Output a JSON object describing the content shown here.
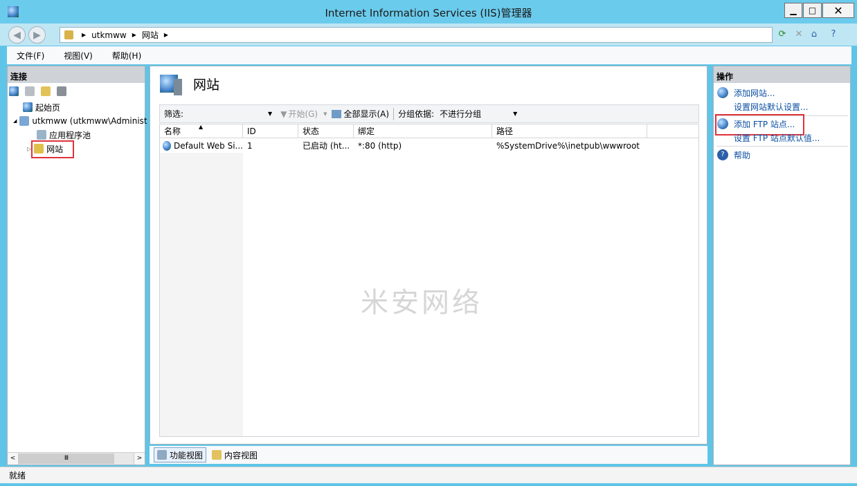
{
  "window": {
    "title": "Internet Information Services (IIS)管理器",
    "min_glyph": "▁",
    "max_glyph": "□",
    "close_glyph": "✕"
  },
  "address": {
    "crumbs": [
      "utkmww",
      "网站"
    ],
    "sep": "▶"
  },
  "menu": [
    "文件(F)",
    "视图(V)",
    "帮助(H)"
  ],
  "connections": {
    "header": "连接",
    "tree": [
      {
        "label": "起始页"
      },
      {
        "label": "utkmww (utkmww\\Administ"
      },
      {
        "label": "应用程序池"
      },
      {
        "label": "网站"
      }
    ],
    "expander_open": "◢",
    "expander_closed": "▷",
    "scroll_thumb": "Ⅲ"
  },
  "center": {
    "title": "网站",
    "filter_label": "筛选:",
    "start_label": "开始(G)",
    "show_all_label": "全部显示(A)",
    "group_label": "分组依据:",
    "group_value": "不进行分组",
    "columns": [
      "名称",
      "ID",
      "状态",
      "绑定",
      "路径"
    ],
    "rows": [
      {
        "name": "Default Web Si...",
        "id": "1",
        "status": "已启动 (ht...",
        "binding": "*:80 (http)",
        "path": "%SystemDrive%\\inetpub\\wwwroot"
      }
    ],
    "watermark": "米安网络"
  },
  "view_tabs": [
    "功能视图",
    "内容视图"
  ],
  "actions": {
    "header": "操作",
    "items": [
      {
        "label": "添加网站..."
      },
      {
        "label": "设置网站默认设置..."
      },
      {
        "label": "添加 FTP 站点..."
      },
      {
        "label": "设置 FTP 站点默认值..."
      },
      {
        "label": "帮助"
      }
    ]
  },
  "status": {
    "text": "就绪"
  },
  "colors": {
    "highlight": "#e0323c",
    "link": "#0b4ea2",
    "titlebar": "#6bcbec"
  }
}
